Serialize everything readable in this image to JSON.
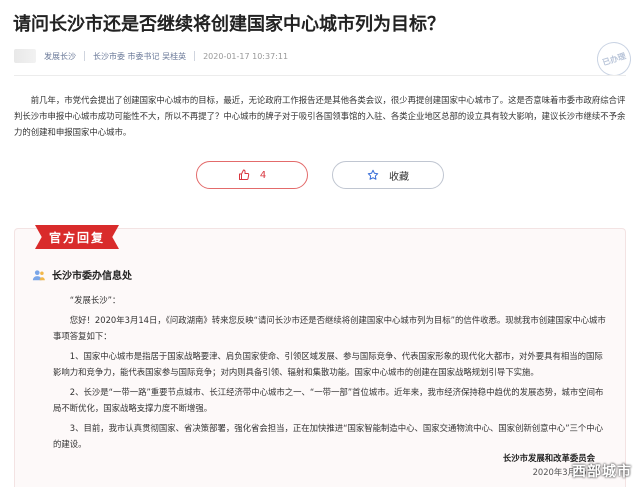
{
  "question": {
    "title": "请问长沙市还是否继续将创建国家中心城市列为目标？",
    "author": "发展长沙",
    "target": "长沙市委 市委书记 吴桂英",
    "time": "2020-01-17 10:37:11",
    "stamp_text": "已办理",
    "content": "前几年，市党代会提出了创建国家中心城市的目标，最近，无论政府工作报告还是其他各类会议，很少再提创建国家中心城市了。这是否意味着市委市政府综合评判长沙市申报中心城市成功可能性不大，所以不再提了？中心城市的牌子对于吸引各国领事馆的入驻、各类企业地区总部的设立具有较大影响，建议长沙市继续不予余力的创建和申报国家中心城市。"
  },
  "actions": {
    "like_count": "4",
    "favorite_label": "收藏"
  },
  "reply": {
    "ribbon": "官方回复",
    "department": "长沙市委办信息处",
    "greeting": "“发展长沙”：",
    "para1": "您好！2020年3月14日，《问政湖南》转来您反映“请问长沙市还是否继续将创建国家中心城市列为目标”的信件收悉。现就我市创建国家中心城市事项答复如下：",
    "para2": "1、国家中心城市是指居于国家战略要津、肩负国家使命、引领区域发展、参与国际竞争、代表国家形象的现代化大都市，对外要具有相当的国际影响力和竞争力，能代表国家参与国际竞争；对内则具备引领、辐射和集散功能。国家中心城市的创建在国家战略规划引导下实施。",
    "para3": "2、长沙是“一带一路”重要节点城市、长江经济带中心城市之一、“一带一部”首位城市。近年来，我市经济保持稳中趋优的发展态势，城市空间布局不断优化，国家战略支撑力度不断增强。",
    "para4": "3、目前，我市认真贯彻国家、省决策部署，强化省会担当，正在加快推进“国家智能制造中心、国家交通物流中心、国家创新创意中心”三个中心的建设。",
    "sign_org": "长沙市发展和改革委员会",
    "sign_date": "2020年3月16日"
  },
  "watermark": "西部城市",
  "colors": {
    "accent_red": "#d92b2b",
    "meta_blue": "#6b7a99"
  }
}
